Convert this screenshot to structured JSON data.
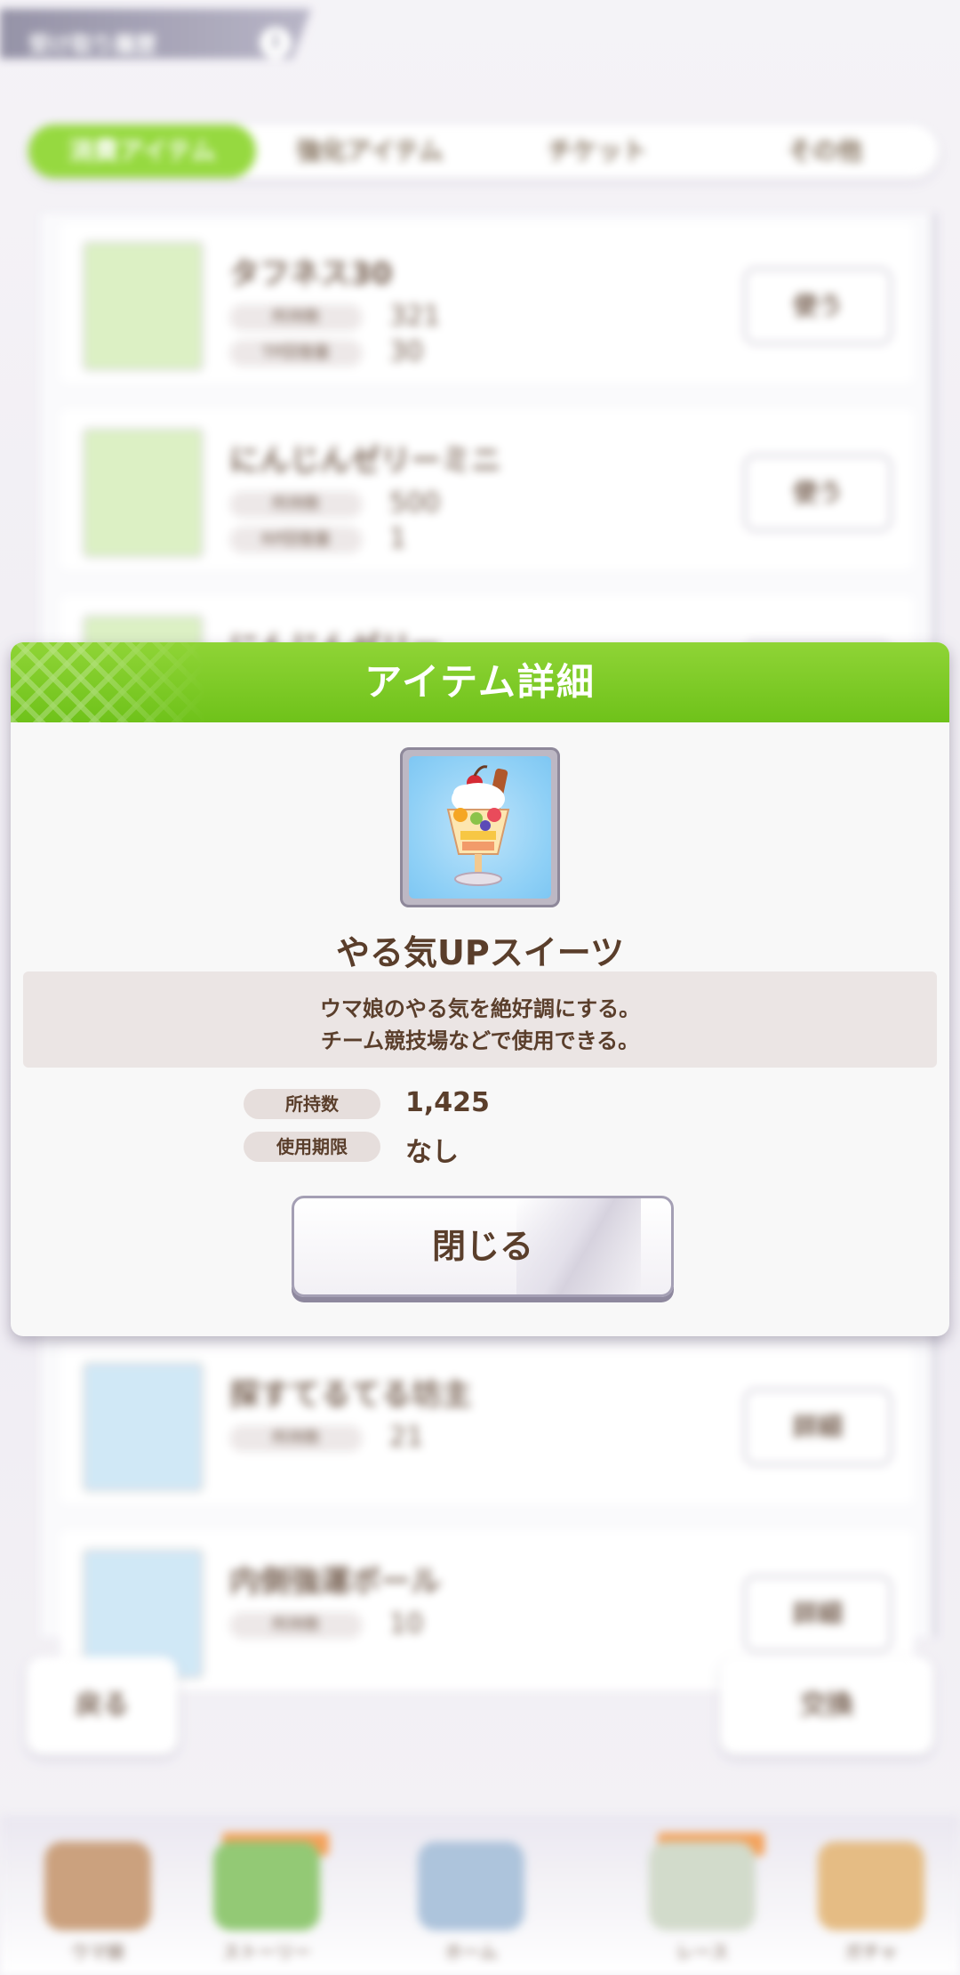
{
  "background": {
    "top_label": "受け取り履歴",
    "top_info": "i",
    "tabs": [
      {
        "label": "消費アイテム",
        "active": true
      },
      {
        "label": "強化アイテム",
        "active": false
      },
      {
        "label": "チケット",
        "active": false
      },
      {
        "label": "その他",
        "active": false
      }
    ],
    "rows": [
      {
        "name": "タフネス30",
        "k1": "所持数",
        "v1": "321",
        "k2": "TP回復量",
        "v2": "30",
        "button": "使う"
      },
      {
        "name": "にんじんゼリーミニ",
        "k1": "所持数",
        "v1": "500",
        "k2": "RP回復量",
        "v2": "1",
        "button": "使う"
      },
      {
        "name": "にんじんゼリー",
        "k1": "",
        "v1": "",
        "k2": "",
        "v2": "",
        "button": "使う"
      },
      {
        "name": "探すてるてる坊主",
        "k1": "所持数",
        "v1": "21",
        "k2": "",
        "v2": "",
        "button": "詳細"
      },
      {
        "name": "内側強運ボール",
        "k1": "所持数",
        "v1": "10",
        "k2": "",
        "v2": "",
        "button": "詳細"
      }
    ],
    "back_button": "戻る",
    "shop_button": "交換",
    "nav": [
      "ウマ娘",
      "ストーリー",
      "ホーム",
      "レース",
      "ガチャ"
    ]
  },
  "dialog": {
    "title": "アイテム詳細",
    "item_name": "やる気UPスイーツ",
    "icon": "parfait-icon",
    "description": [
      "ウマ娘のやる気を絶好調にする。",
      "チーム競技場などで使用できる。"
    ],
    "stats": [
      {
        "label": "所持数",
        "value": "1,425"
      },
      {
        "label": "使用期限",
        "value": "なし"
      }
    ],
    "close_button": "閉じる"
  },
  "colors": {
    "header_green": "#7cc81f",
    "text_brown": "#5a3e2b",
    "desc_bg": "#ebe5e4"
  }
}
